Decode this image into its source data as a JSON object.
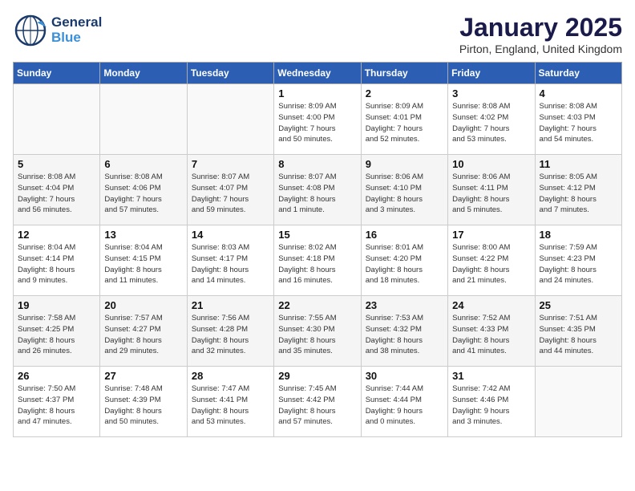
{
  "header": {
    "logo_general": "General",
    "logo_blue": "Blue",
    "month": "January 2025",
    "location": "Pirton, England, United Kingdom"
  },
  "days_of_week": [
    "Sunday",
    "Monday",
    "Tuesday",
    "Wednesday",
    "Thursday",
    "Friday",
    "Saturday"
  ],
  "weeks": [
    [
      {
        "day": "",
        "detail": ""
      },
      {
        "day": "",
        "detail": ""
      },
      {
        "day": "",
        "detail": ""
      },
      {
        "day": "1",
        "detail": "Sunrise: 8:09 AM\nSunset: 4:00 PM\nDaylight: 7 hours\nand 50 minutes."
      },
      {
        "day": "2",
        "detail": "Sunrise: 8:09 AM\nSunset: 4:01 PM\nDaylight: 7 hours\nand 52 minutes."
      },
      {
        "day": "3",
        "detail": "Sunrise: 8:08 AM\nSunset: 4:02 PM\nDaylight: 7 hours\nand 53 minutes."
      },
      {
        "day": "4",
        "detail": "Sunrise: 8:08 AM\nSunset: 4:03 PM\nDaylight: 7 hours\nand 54 minutes."
      }
    ],
    [
      {
        "day": "5",
        "detail": "Sunrise: 8:08 AM\nSunset: 4:04 PM\nDaylight: 7 hours\nand 56 minutes."
      },
      {
        "day": "6",
        "detail": "Sunrise: 8:08 AM\nSunset: 4:06 PM\nDaylight: 7 hours\nand 57 minutes."
      },
      {
        "day": "7",
        "detail": "Sunrise: 8:07 AM\nSunset: 4:07 PM\nDaylight: 7 hours\nand 59 minutes."
      },
      {
        "day": "8",
        "detail": "Sunrise: 8:07 AM\nSunset: 4:08 PM\nDaylight: 8 hours\nand 1 minute."
      },
      {
        "day": "9",
        "detail": "Sunrise: 8:06 AM\nSunset: 4:10 PM\nDaylight: 8 hours\nand 3 minutes."
      },
      {
        "day": "10",
        "detail": "Sunrise: 8:06 AM\nSunset: 4:11 PM\nDaylight: 8 hours\nand 5 minutes."
      },
      {
        "day": "11",
        "detail": "Sunrise: 8:05 AM\nSunset: 4:12 PM\nDaylight: 8 hours\nand 7 minutes."
      }
    ],
    [
      {
        "day": "12",
        "detail": "Sunrise: 8:04 AM\nSunset: 4:14 PM\nDaylight: 8 hours\nand 9 minutes."
      },
      {
        "day": "13",
        "detail": "Sunrise: 8:04 AM\nSunset: 4:15 PM\nDaylight: 8 hours\nand 11 minutes."
      },
      {
        "day": "14",
        "detail": "Sunrise: 8:03 AM\nSunset: 4:17 PM\nDaylight: 8 hours\nand 14 minutes."
      },
      {
        "day": "15",
        "detail": "Sunrise: 8:02 AM\nSunset: 4:18 PM\nDaylight: 8 hours\nand 16 minutes."
      },
      {
        "day": "16",
        "detail": "Sunrise: 8:01 AM\nSunset: 4:20 PM\nDaylight: 8 hours\nand 18 minutes."
      },
      {
        "day": "17",
        "detail": "Sunrise: 8:00 AM\nSunset: 4:22 PM\nDaylight: 8 hours\nand 21 minutes."
      },
      {
        "day": "18",
        "detail": "Sunrise: 7:59 AM\nSunset: 4:23 PM\nDaylight: 8 hours\nand 24 minutes."
      }
    ],
    [
      {
        "day": "19",
        "detail": "Sunrise: 7:58 AM\nSunset: 4:25 PM\nDaylight: 8 hours\nand 26 minutes."
      },
      {
        "day": "20",
        "detail": "Sunrise: 7:57 AM\nSunset: 4:27 PM\nDaylight: 8 hours\nand 29 minutes."
      },
      {
        "day": "21",
        "detail": "Sunrise: 7:56 AM\nSunset: 4:28 PM\nDaylight: 8 hours\nand 32 minutes."
      },
      {
        "day": "22",
        "detail": "Sunrise: 7:55 AM\nSunset: 4:30 PM\nDaylight: 8 hours\nand 35 minutes."
      },
      {
        "day": "23",
        "detail": "Sunrise: 7:53 AM\nSunset: 4:32 PM\nDaylight: 8 hours\nand 38 minutes."
      },
      {
        "day": "24",
        "detail": "Sunrise: 7:52 AM\nSunset: 4:33 PM\nDaylight: 8 hours\nand 41 minutes."
      },
      {
        "day": "25",
        "detail": "Sunrise: 7:51 AM\nSunset: 4:35 PM\nDaylight: 8 hours\nand 44 minutes."
      }
    ],
    [
      {
        "day": "26",
        "detail": "Sunrise: 7:50 AM\nSunset: 4:37 PM\nDaylight: 8 hours\nand 47 minutes."
      },
      {
        "day": "27",
        "detail": "Sunrise: 7:48 AM\nSunset: 4:39 PM\nDaylight: 8 hours\nand 50 minutes."
      },
      {
        "day": "28",
        "detail": "Sunrise: 7:47 AM\nSunset: 4:41 PM\nDaylight: 8 hours\nand 53 minutes."
      },
      {
        "day": "29",
        "detail": "Sunrise: 7:45 AM\nSunset: 4:42 PM\nDaylight: 8 hours\nand 57 minutes."
      },
      {
        "day": "30",
        "detail": "Sunrise: 7:44 AM\nSunset: 4:44 PM\nDaylight: 9 hours\nand 0 minutes."
      },
      {
        "day": "31",
        "detail": "Sunrise: 7:42 AM\nSunset: 4:46 PM\nDaylight: 9 hours\nand 3 minutes."
      },
      {
        "day": "",
        "detail": ""
      }
    ]
  ]
}
